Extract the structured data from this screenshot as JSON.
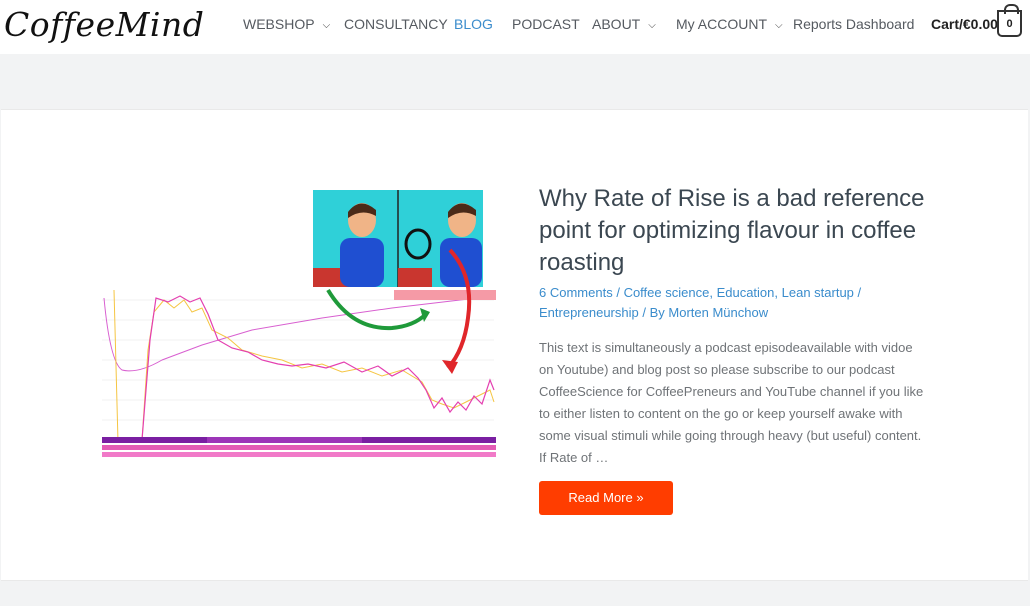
{
  "header": {
    "logo_text": "CoffeeMind",
    "nav": {
      "webshop": "WEBSHOP",
      "consultancy": "CONSULTANCY",
      "blog": "BLOG",
      "podcast": "PODCAST",
      "about": "ABOUT",
      "my_account": "My ACCOUNT",
      "reports": "Reports Dashboard"
    },
    "cart_label": "Cart/€0.00",
    "cart_count": "0"
  },
  "post": {
    "title": "Why Rate of Rise is a bad reference point for optimizing flavour in coffee roasting",
    "comments": "6 Comments",
    "categories": [
      "Coffee science",
      "Education",
      "Lean startup",
      "Entrepreneurship"
    ],
    "by_label": "By",
    "author": "Morten Münchow",
    "excerpt": "This text is simultaneously a podcast episodeavailable with vidoe on Youtube) and blog post so please subscribe to our podcast CoffeeScience for CoffeePreneurs and YouTube channel if you like to either listen to content on the go or keep yourself awake with some visual stimuli while going through heavy (but useful) content. If Rate of …",
    "read_more": "Read More »"
  },
  "colors": {
    "accent": "#ff3d00",
    "link": "#3a8ccc",
    "title": "#3b4751"
  }
}
